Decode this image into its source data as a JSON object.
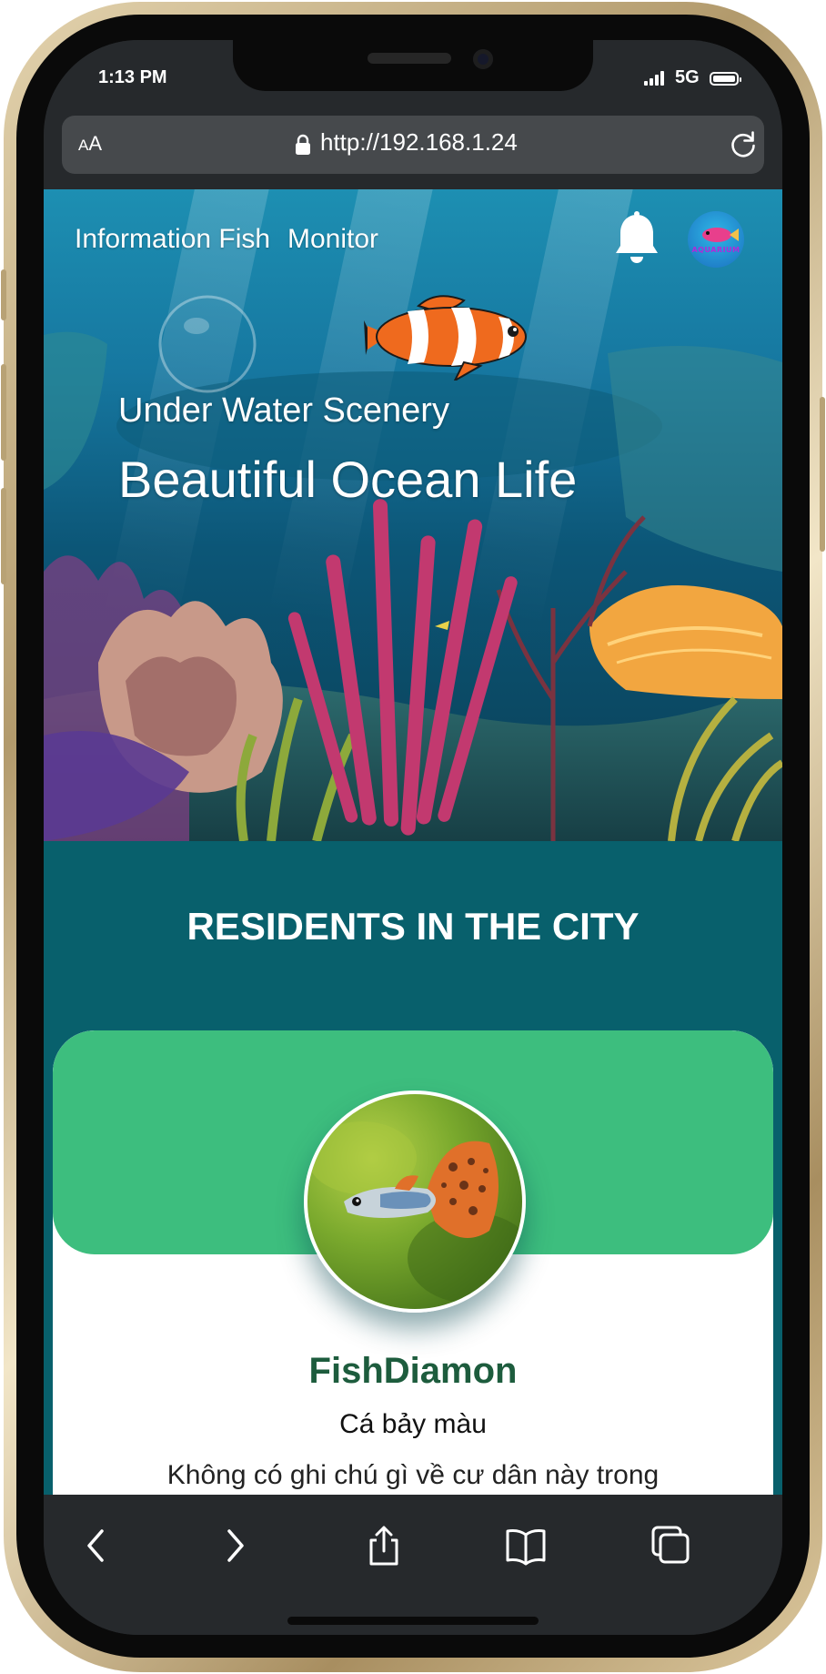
{
  "status_bar": {
    "time": "1:13 PM",
    "network": "5G",
    "signal_icon": "signal-bars-icon",
    "battery_icon": "battery-full-icon"
  },
  "browser": {
    "text_size_button": {
      "small": "A",
      "large": "A"
    },
    "url": "http://192.168.1.24",
    "lock_icon": "lock-icon",
    "reload_icon": "reload-icon"
  },
  "page": {
    "nav": {
      "links": [
        "Information Fish",
        "Monitor"
      ],
      "notification_icon": "bell-icon",
      "avatar_label": "AQUARIUM"
    },
    "hero": {
      "subtitle": "Under Water Scenery",
      "headline": "Beautiful Ocean Life"
    },
    "section_title": "RESIDENTS IN THE CITY",
    "resident_card": {
      "name": "FishDiamon",
      "species": "Cá bảy màu",
      "note": "Không có ghi chú gì về cư dân này trong"
    }
  },
  "toolbar": {
    "icons": [
      "back-icon",
      "forward-icon",
      "share-icon",
      "bookmarks-icon",
      "tabs-icon"
    ]
  },
  "colors": {
    "page_background": "#08606c",
    "card_header": "#3dbe7e",
    "card_name": "#1d5c3d",
    "browser_chrome": "#26292c",
    "phone_frame": "#c8b287"
  }
}
